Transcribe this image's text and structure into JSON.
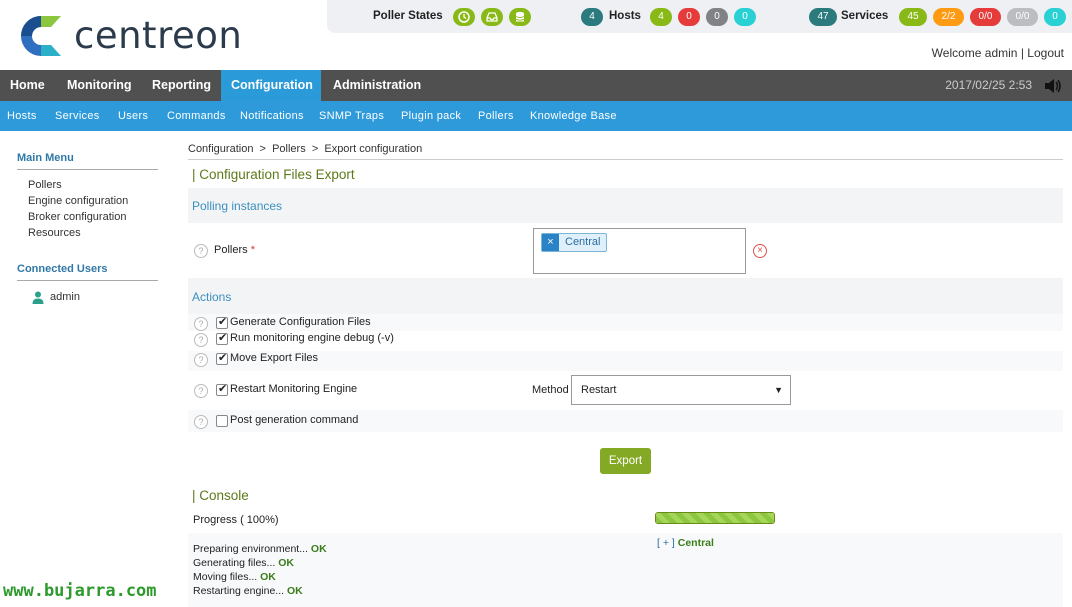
{
  "brand": {
    "name": "centreon"
  },
  "status_bar": {
    "poller_states_label": "Poller States",
    "hosts": {
      "total": "4",
      "label": "Hosts",
      "up": "4",
      "down": "0",
      "unreachable": "0",
      "pending": "0"
    },
    "services": {
      "total": "47",
      "label": "Services",
      "ok": "45",
      "warning": "2/2",
      "critical": "0/0",
      "unknown": "0/0",
      "pending": "0"
    }
  },
  "user": {
    "welcome": "Welcome admin",
    "separator": "|",
    "logout": "Logout"
  },
  "topnav": {
    "items": [
      "Home",
      "Monitoring",
      "Reporting",
      "Configuration",
      "Administration"
    ],
    "active": "Configuration",
    "datetime": "2017/02/25 2:53"
  },
  "subnav": {
    "items": [
      "Hosts",
      "Services",
      "Users",
      "Commands",
      "Notifications",
      "SNMP Traps",
      "Plugin pack",
      "Pollers",
      "Knowledge Base"
    ]
  },
  "sidebar": {
    "main_menu_title": "Main Menu",
    "main_menu_items": [
      "Pollers",
      "Engine configuration",
      "Broker configuration",
      "Resources"
    ],
    "connected_users_title": "Connected Users",
    "connected_users": [
      "admin"
    ]
  },
  "main": {
    "breadcrumb": "Configuration  >  Pollers  >  Export configuration",
    "page_title": "| Configuration Files Export",
    "polling_section": "Polling instances",
    "pollers_label": "Pollers",
    "required_mark": "*",
    "selected_pollers": [
      "Central"
    ],
    "actions_section": "Actions",
    "actions": [
      {
        "label": "Generate Configuration Files",
        "checked": true
      },
      {
        "label": "Run monitoring engine debug (-v)",
        "checked": true
      },
      {
        "label": "Move Export Files",
        "checked": true
      },
      {
        "label": "Restart Monitoring Engine",
        "checked": true
      },
      {
        "label": "Post generation command",
        "checked": false
      }
    ],
    "method_label": "Method",
    "method_value": "Restart",
    "export_button": "Export",
    "console_title": "| Console",
    "progress_label": "Progress ( 100%)",
    "progress_percent": 100,
    "console_poller_toggle": "[ + ]",
    "console_poller_name": "Central",
    "log": [
      {
        "text": "Preparing environment...",
        "status": "OK"
      },
      {
        "text": "Generating files...",
        "status": "OK"
      },
      {
        "text": "Moving files...",
        "status": "OK"
      },
      {
        "text": "Restarting engine...",
        "status": "OK"
      }
    ]
  },
  "watermark": "www.bujarra.com",
  "colors": {
    "nav_bg": "#505050",
    "accent_blue": "#2e9ad9",
    "accent_green": "#84a925",
    "host_up": "#88b917",
    "host_down": "#e63b3b",
    "unreachable": "#818285",
    "pending": "#2ad1d4",
    "warning": "#ff9a13",
    "unknown": "#bcbdc0",
    "total_teal": "#2a7a7e"
  }
}
